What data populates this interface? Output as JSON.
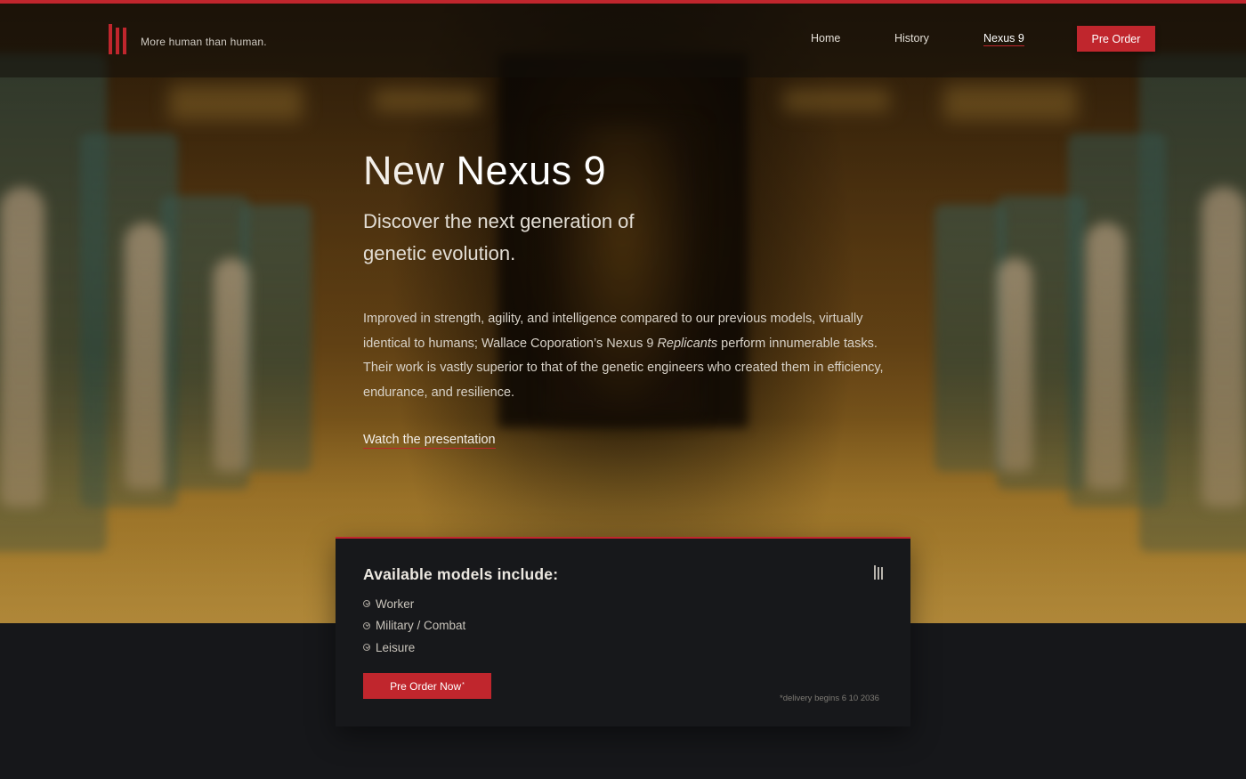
{
  "header": {
    "tagline": "More human than human.",
    "nav": [
      {
        "label": "Home"
      },
      {
        "label": "History"
      },
      {
        "label": "Nexus 9",
        "active": true
      }
    ],
    "cta_label": "Pre Order"
  },
  "hero": {
    "title_light": "New",
    "title_strong": "Nexus 9",
    "subtitle": "Discover the next generation of genetic evolution.",
    "body_before": "Improved in strength, agility, and intelligence compared to our previous models, virtually identical to humans; Wallace Coporation’s Nexus 9 ",
    "body_italic": "Replicants",
    "body_after": " perform innumerable tasks. Their work is vastly superior to that of the genetic engineers who created them in efficiency, endurance, and resilience.",
    "link_label": "Watch the presentation"
  },
  "card": {
    "title": "Available models include:",
    "models": [
      "Worker",
      "Military / Combat",
      "Leisure"
    ],
    "button_label": "Pre Order Now",
    "button_mark": "*",
    "delivery_note": "*delivery begins 6 10 2036"
  },
  "colors": {
    "accent": "#c0262d",
    "page_background": "#16171a",
    "card_background": "#17181b"
  },
  "icons": {
    "logo": "three-bars-logo-icon",
    "list_bullet": "check-circle-icon",
    "card_logo": "three-bars-logo-icon"
  }
}
